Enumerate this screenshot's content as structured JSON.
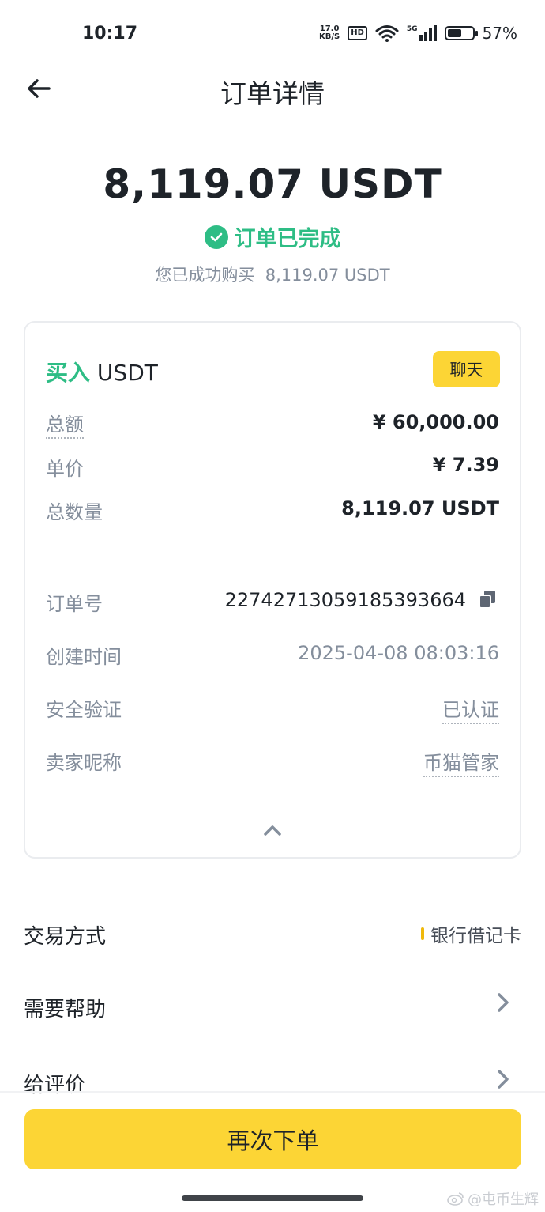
{
  "status_bar": {
    "time": "10:17",
    "net_speed_value": "17.0",
    "net_speed_unit": "KB/S",
    "hd_badge": "HD",
    "network": "5G",
    "battery_percent": "57%",
    "battery_level": 0.57
  },
  "header": {
    "title": "订单详情"
  },
  "hero": {
    "amount": "8,119.07 USDT",
    "status": "订单已完成",
    "sub_prefix": "您已成功购买",
    "sub_amount": "8,119.07 USDT"
  },
  "card": {
    "side": "买入",
    "asset": "USDT",
    "chat_label": "聊天",
    "rows": [
      {
        "label": "总额",
        "value": "¥ 60,000.00"
      },
      {
        "label": "单价",
        "value": "¥ 7.39"
      },
      {
        "label": "总数量",
        "value": "8,119.07 USDT"
      }
    ],
    "details": [
      {
        "label": "订单号",
        "value": "22742713059185393664"
      },
      {
        "label": "创建时间",
        "value": "2025-04-08 08:03:16"
      },
      {
        "label": "安全验证",
        "value": "已认证"
      },
      {
        "label": "卖家昵称",
        "value": "币猫管家"
      }
    ]
  },
  "list": {
    "payment_label": "交易方式",
    "payment_value": "银行借记卡",
    "help_label": "需要帮助",
    "review_label": "给评价"
  },
  "bottom": {
    "reorder_label": "再次下单"
  },
  "watermark": "@屯币生辉",
  "colors": {
    "accent": "#fcd535",
    "success": "#2ebd85",
    "muted": "#848e9c",
    "text": "#1e2329"
  }
}
